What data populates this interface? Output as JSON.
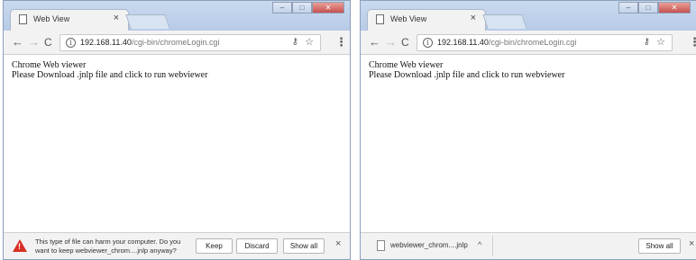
{
  "left_window": {
    "tab": {
      "title": "Web View",
      "close": "×"
    },
    "window_controls": {
      "minimize": "–",
      "maximize": "□",
      "close": "✕"
    },
    "toolbar": {
      "back": "←",
      "forward": "→",
      "reload": "C",
      "info": "i",
      "url_host": "192.168.11.40",
      "url_path": "/cgi-bin/chromeLogin.cgi",
      "key": "⚷",
      "star": "☆",
      "menu": "⋮"
    },
    "page": {
      "line1": "Chrome Web viewer",
      "line2": "Please Download .jnlp file and click to run webviewer"
    },
    "download_bar": {
      "warning_icon_mark": "!",
      "warning_text": "This type of file can harm your computer. Do you want to keep webviewer_chrom....jnlp anyway?",
      "keep_label": "Keep",
      "discard_label": "Discard",
      "show_all_label": "Show all",
      "close": "×"
    }
  },
  "right_window": {
    "tab": {
      "title": "Web View",
      "close": "×"
    },
    "window_controls": {
      "minimize": "–",
      "maximize": "□",
      "close": "✕"
    },
    "toolbar": {
      "back": "←",
      "forward": "→",
      "reload": "C",
      "info": "i",
      "url_host": "192.168.11.40",
      "url_path": "/cgi-bin/chromeLogin.cgi",
      "key": "⚷",
      "star": "☆",
      "menu": "⋮"
    },
    "page": {
      "line1": "Chrome Web viewer",
      "line2": "Please Download .jnlp file and click to run webviewer"
    },
    "download_bar": {
      "file_name": "webviewer_chrom....jnlp",
      "chevron": "^",
      "show_all_label": "Show all",
      "close": "×"
    }
  },
  "colors": {
    "titlebar": "#c1d3ea",
    "toolbar": "#f2f2f2",
    "warning": "#d93025",
    "window_close": "#c75050"
  }
}
